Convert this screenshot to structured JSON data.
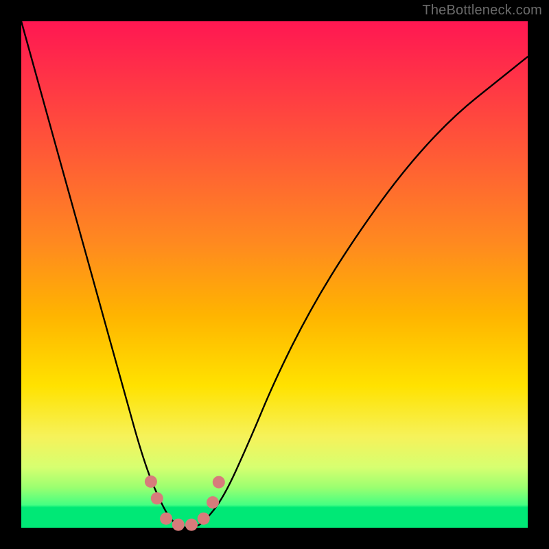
{
  "watermark": "TheBottleneck.com",
  "colors": {
    "frame": "#000000",
    "gradient_top": "#ff1752",
    "gradient_mid": "#ffe200",
    "gradient_bottom": "#00e876",
    "curve": "#000000",
    "markers": "#d77b7b"
  },
  "chart_data": {
    "type": "line",
    "title": "",
    "xlabel": "",
    "ylabel": "",
    "x_range": [
      0,
      1
    ],
    "y_range": [
      0,
      1
    ],
    "series": [
      {
        "name": "bottleneck-curve",
        "x": [
          0.0,
          0.05,
          0.1,
          0.15,
          0.2,
          0.245,
          0.28,
          0.3,
          0.32,
          0.34,
          0.36,
          0.4,
          0.45,
          0.5,
          0.57,
          0.65,
          0.75,
          0.85,
          0.95,
          1.0
        ],
        "y": [
          1.0,
          0.82,
          0.64,
          0.46,
          0.28,
          0.12,
          0.04,
          0.01,
          0.0,
          0.0,
          0.01,
          0.06,
          0.17,
          0.29,
          0.43,
          0.56,
          0.7,
          0.81,
          0.89,
          0.93
        ]
      }
    ],
    "markers": {
      "name": "highlight-points",
      "x": [
        0.256,
        0.268,
        0.286,
        0.31,
        0.336,
        0.36,
        0.378,
        0.39
      ],
      "y": [
        0.091,
        0.058,
        0.018,
        0.006,
        0.006,
        0.018,
        0.05,
        0.09
      ]
    }
  }
}
